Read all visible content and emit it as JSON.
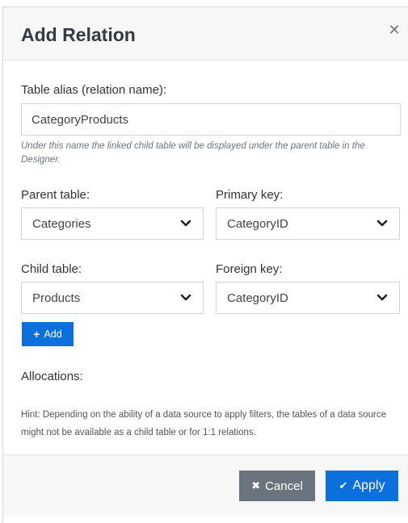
{
  "dialog": {
    "title": "Add Relation",
    "close_icon": "close-icon"
  },
  "form": {
    "alias_label": "Table alias (relation name):",
    "alias_value": "CategoryProducts",
    "alias_help": "Under this name the linked child table will be displayed under the parent table in the Designer.",
    "parent_table_label": "Parent table:",
    "parent_table_value": "Categories",
    "primary_key_label": "Primary key:",
    "primary_key_value": "CategoryID",
    "child_table_label": "Child table:",
    "child_table_value": "Products",
    "foreign_key_label": "Foreign key:",
    "foreign_key_value": "CategoryID",
    "add_button_label": "Add",
    "add_icon": "plus-icon",
    "allocations_label": "Allocations:",
    "hint": "Hint: Depending on the ability of a data source to apply filters, the tables of a data source might not be available as a child table or for 1:1 relations."
  },
  "footer": {
    "cancel_label": "Cancel",
    "cancel_icon": "times-icon",
    "apply_label": "Apply",
    "apply_icon": "check-icon"
  },
  "colors": {
    "primary": "#0b6fdc",
    "secondary": "#6b747c",
    "header_bg": "#f7f7f7"
  }
}
